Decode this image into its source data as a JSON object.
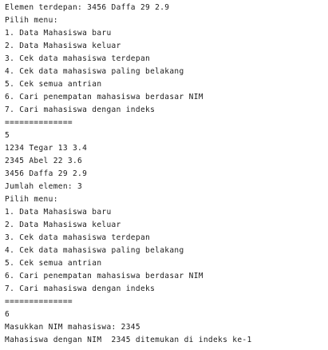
{
  "console": {
    "lines": [
      "Elemen terdepan: 3456 Daffa 29 2.9",
      "Pilih menu:",
      "1. Data Mahasiswa baru",
      "2. Data Mahasiswa keluar",
      "3. Cek data mahasiswa terdepan",
      "4. Cek data mahasiswa paling belakang",
      "5. Cek semua antrian",
      "6. Cari penempatan mahasiswa berdasar NIM",
      "7. Cari mahasiswa dengan indeks",
      "==============",
      "5",
      "1234 Tegar 13 3.4",
      "2345 Abel 22 3.6",
      "3456 Daffa 29 2.9",
      "Jumlah elemen: 3",
      "Pilih menu:",
      "1. Data Mahasiswa baru",
      "2. Data Mahasiswa keluar",
      "3. Cek data mahasiswa terdepan",
      "4. Cek data mahasiswa paling belakang",
      "5. Cek semua antrian",
      "6. Cari penempatan mahasiswa berdasar NIM",
      "7. Cari mahasiswa dengan indeks",
      "==============",
      "6",
      "Masukkan NIM mahasiswa: 2345",
      "Mahasiswa dengan NIM  2345 ditemukan di indeks ke-1"
    ]
  }
}
